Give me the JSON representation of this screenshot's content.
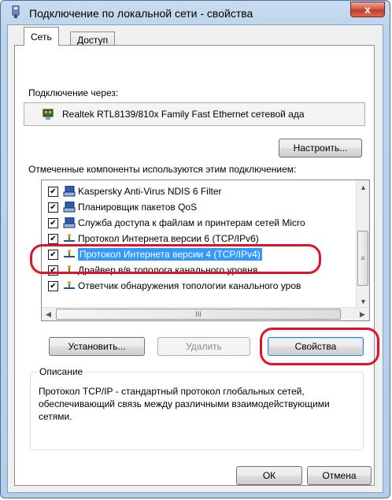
{
  "window": {
    "title": "Подключение по локальной сети - свойства",
    "close_glyph": "x"
  },
  "tabs": [
    {
      "label": "Сеть",
      "active": true
    },
    {
      "label": "Доступ",
      "active": false
    }
  ],
  "connect_via": {
    "label": "Подключение через:",
    "adapter": "Realtek RTL8139/810x Family Fast Ethernet сетевой ада",
    "configure_button": "Настроить..."
  },
  "components": {
    "label": "Отмеченные компоненты используются этим подключением:",
    "items": [
      {
        "label": "Kaspersky Anti-Virus NDIS 6 Filter",
        "checked": true,
        "icon": "network-client-icon"
      },
      {
        "label": "Планировщик пакетов QoS",
        "checked": true,
        "icon": "network-service-icon"
      },
      {
        "label": "Служба доступа к файлам и принтерам сетей Micro",
        "checked": true,
        "icon": "network-service-icon"
      },
      {
        "label": "Протокол Интернета версии 6 (TCP/IPv6)",
        "checked": true,
        "icon": "network-protocol-icon"
      },
      {
        "label": "Протокол Интернета версии 4 (TCP/IPv4)",
        "checked": true,
        "icon": "network-protocol-icon",
        "selected": true
      },
      {
        "label": "Драйвер в/в тополога канального уровня",
        "checked": true,
        "icon": "network-protocol-icon"
      },
      {
        "label": "Ответчик обнаружения топологии канального уров",
        "checked": true,
        "icon": "network-protocol-icon"
      }
    ],
    "check_glyph": "✔",
    "hscroll_thumb_glyph": "III",
    "vscroll_thumb_glyph": "≡"
  },
  "actions": {
    "install": "Установить...",
    "remove": "Удалить",
    "properties": "Свойства"
  },
  "description": {
    "title": "Описание",
    "text": "Протокол TCP/IP - стандартный протокол глобальных сетей, обеспечивающий связь между различными взаимодействующими сетями."
  },
  "footer": {
    "ok": "ОК",
    "cancel": "Отмена"
  },
  "colors": {
    "selection": "#3399ff",
    "highlight_ring": "#e0132a",
    "close_button": "#c13b23"
  }
}
